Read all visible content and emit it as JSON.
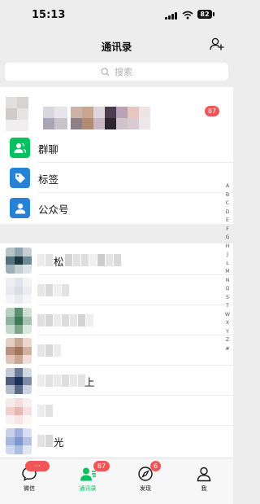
{
  "status_bar": {
    "time": "15:13",
    "battery": "82"
  },
  "header": {
    "title": "通讯录"
  },
  "search": {
    "placeholder": "搜索"
  },
  "new_friends": {
    "badge": "87"
  },
  "functions": [
    {
      "label": "群聊",
      "icon": "group-chat-icon",
      "color": "#07c160"
    },
    {
      "label": "标签",
      "icon": "tag-icon",
      "color": "#2782d7"
    },
    {
      "label": "公众号",
      "icon": "official-account-icon",
      "color": "#2782d7"
    }
  ],
  "contacts": [
    {
      "visible_text": "松"
    },
    {
      "visible_text": ""
    },
    {
      "visible_text": ""
    },
    {
      "visible_text": ""
    },
    {
      "visible_text": "上"
    },
    {
      "visible_text": ""
    },
    {
      "visible_text": "光"
    }
  ],
  "alpha_index": [
    "A",
    "B",
    "C",
    "D",
    "E",
    "F",
    "G",
    "H",
    "J",
    "L",
    "M",
    "N",
    "Q",
    "S",
    "T",
    "W",
    "X",
    "Y",
    "Z",
    "#"
  ],
  "tabs": [
    {
      "label": "微信",
      "badge": "···",
      "active": false
    },
    {
      "label": "通讯录",
      "badge": "87",
      "active": true
    },
    {
      "label": "发现",
      "badge": "6",
      "active": false
    },
    {
      "label": "我",
      "badge": "",
      "active": false
    }
  ],
  "colors": {
    "accent": "#07c160",
    "badge": "#f25555",
    "blue": "#2782d7"
  }
}
